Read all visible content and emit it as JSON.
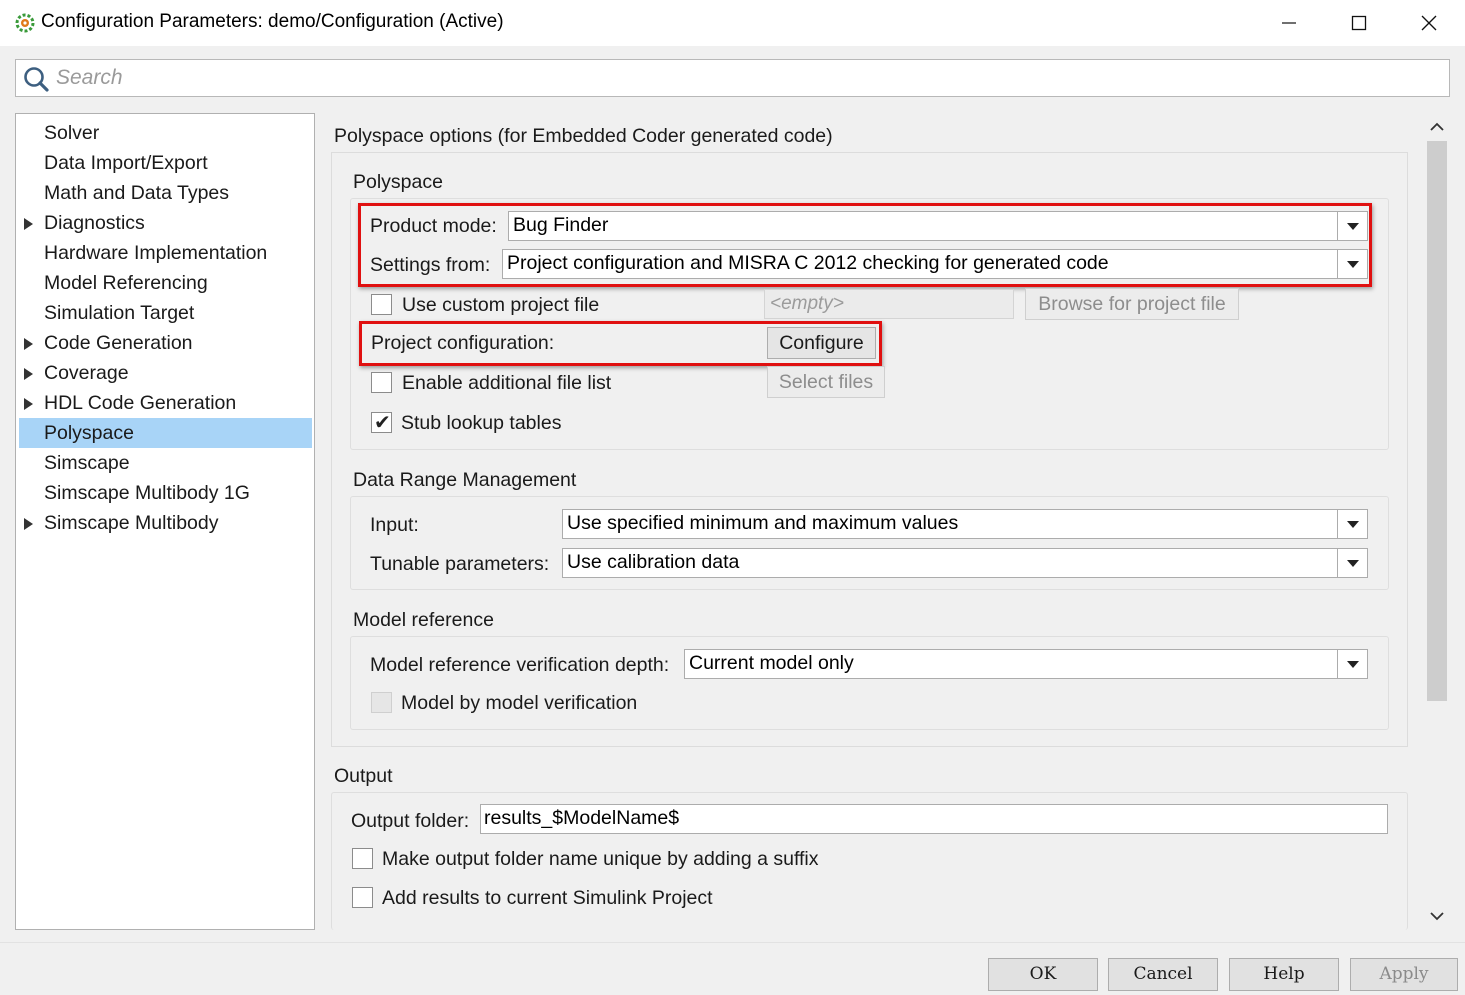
{
  "window": {
    "title": "Configuration Parameters: demo/Configuration (Active)"
  },
  "search": {
    "placeholder": "Search",
    "value": ""
  },
  "sidebar": {
    "items": [
      {
        "label": "Solver",
        "expandable": false,
        "selected": false
      },
      {
        "label": "Data Import/Export",
        "expandable": false,
        "selected": false
      },
      {
        "label": "Math and Data Types",
        "expandable": false,
        "selected": false
      },
      {
        "label": "Diagnostics",
        "expandable": true,
        "selected": false
      },
      {
        "label": "Hardware Implementation",
        "expandable": false,
        "selected": false
      },
      {
        "label": "Model Referencing",
        "expandable": false,
        "selected": false
      },
      {
        "label": "Simulation Target",
        "expandable": false,
        "selected": false
      },
      {
        "label": "Code Generation",
        "expandable": true,
        "selected": false
      },
      {
        "label": "Coverage",
        "expandable": true,
        "selected": false
      },
      {
        "label": "HDL Code Generation",
        "expandable": true,
        "selected": false
      },
      {
        "label": "Polyspace",
        "expandable": false,
        "selected": true
      },
      {
        "label": "Simscape",
        "expandable": false,
        "selected": false
      },
      {
        "label": "Simscape Multibody 1G",
        "expandable": false,
        "selected": false
      },
      {
        "label": "Simscape Multibody",
        "expandable": true,
        "selected": false
      }
    ]
  },
  "content": {
    "title": "Polyspace options (for Embedded Coder generated code)",
    "polyspace": {
      "section_title": "Polyspace",
      "product_mode_label": "Product mode:",
      "product_mode_value": "Bug Finder",
      "settings_from_label": "Settings from:",
      "settings_from_value": "Project configuration and MISRA C 2012 checking for generated code",
      "use_custom_label": "Use custom project file",
      "use_custom_checked": false,
      "project_file_placeholder": "<empty>",
      "browse_label": "Browse for project file",
      "project_config_label": "Project configuration:",
      "configure_label": "Configure",
      "enable_file_list_label": "Enable additional file list",
      "enable_file_list_checked": false,
      "select_files_label": "Select files",
      "stub_lookup_label": "Stub lookup tables",
      "stub_lookup_checked": true
    },
    "data_range": {
      "section_title": "Data Range Management",
      "input_label": "Input:",
      "input_value": "Use specified minimum and maximum values",
      "tunable_label": "Tunable parameters:",
      "tunable_value": "Use calibration data"
    },
    "model_reference": {
      "section_title": "Model reference",
      "depth_label": "Model reference verification depth:",
      "depth_value": "Current model only",
      "mbm_label": "Model by model verification",
      "mbm_checked": false
    },
    "output": {
      "section_title": "Output",
      "folder_label": "Output folder:",
      "folder_value": "results_$ModelName$",
      "unique_label": "Make output folder name unique by adding a suffix",
      "unique_checked": false,
      "add_results_label": "Add results to current Simulink Project",
      "add_results_checked": false
    }
  },
  "footer": {
    "ok_label": "OK",
    "cancel_label": "Cancel",
    "help_label": "Help",
    "apply_label": "Apply"
  },
  "colors": {
    "highlight_box": "#e01010",
    "selection": "#a8d4f7"
  }
}
